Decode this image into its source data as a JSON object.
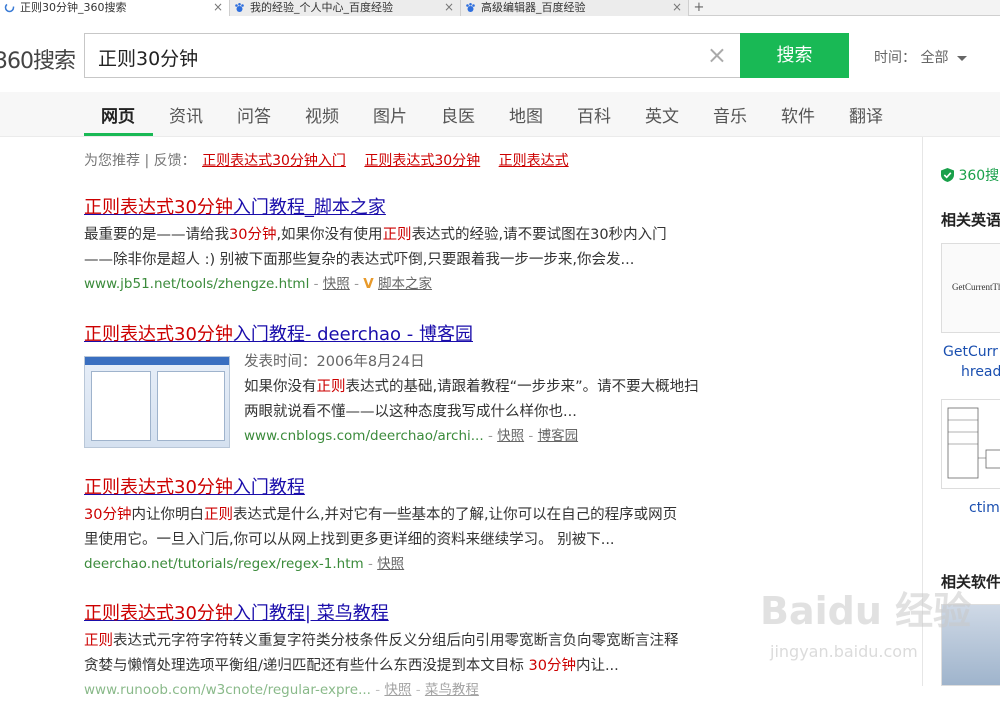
{
  "tabs": [
    {
      "label": "正则30分钟_360搜索",
      "close": "×"
    },
    {
      "label": "我的经验_个人中心_百度经验",
      "close": "×"
    },
    {
      "label": "高级编辑器_百度经验",
      "close": "×"
    }
  ],
  "new_tab": "+",
  "logo": "360搜索",
  "search": {
    "query": "正则30分钟",
    "clear": "×",
    "button": "搜索"
  },
  "time_filter": {
    "label": "时间：",
    "value": "全部"
  },
  "nav": [
    "网页",
    "资讯",
    "问答",
    "视频",
    "图片",
    "良医",
    "地图",
    "百科",
    "英文",
    "音乐",
    "软件",
    "翻译"
  ],
  "recommend": {
    "prefix": "为您推荐 | 反馈：",
    "items": [
      "正则表达式30分钟入门",
      "正则表达式30分钟",
      "正则表达式"
    ]
  },
  "results": [
    {
      "title_red1": "正则",
      "title_mid": "表达式",
      "title_red2": "30分钟",
      "title_rest": "入门教程_脚本之家",
      "snip1_a": "最重要的是——请给我",
      "snip1_red": "30分钟",
      "snip1_b": ",如果你没有使用",
      "snip1_red2": "正则",
      "snip1_c": "表达式的经验,请不要试图在30秒内入门",
      "snip2": "——除非你是超人 :) 别被下面那些复杂的表达式吓倒,只要跟着我一步一步来,你会发...",
      "url": "www.jb51.net/tools/zhengze.html",
      "snap": "快照",
      "vmark": "V",
      "source": "脚本之家"
    },
    {
      "title_red1": "正则",
      "title_mid": "表达式",
      "title_red2": "30分钟",
      "title_rest": "入门教程- deerchao - 博客园",
      "date": "发表时间：2006年8月24日",
      "snip1_a": "如果你没有",
      "snip1_red": "正则",
      "snip1_b": "表达式的基础,请跟着教程“一步步来”。请不要大概地扫",
      "snip2": "两眼就说看不懂——以这种态度我写成什么样你也...",
      "url": "www.cnblogs.com/deerchao/archi...",
      "snap": "快照",
      "source": "博客园"
    },
    {
      "title_red1": "正则",
      "title_mid": "表达式",
      "title_red2": "30分钟",
      "title_rest": "入门教程",
      "snip1_red": "30分钟",
      "snip1_a": "内让你明白",
      "snip1_red2": "正则",
      "snip1_b": "表达式是什么,并对它有一些基本的了解,让你可以在自己的程序或网页",
      "snip2": "里使用它。一旦入门后,你可以从网上找到更多更详细的资料来继续学习。 别被下...",
      "url": "deerchao.net/tutorials/regex/regex-1.htm",
      "snap": "快照"
    },
    {
      "title_red1": "正则",
      "title_mid": "表达式",
      "title_red2": "30分钟",
      "title_rest": "入门教程| 菜鸟教程",
      "snip1_red": "正则",
      "snip1_a": "表达式元字符字符转义重复字符类分枝条件反义分组后向引用零宽断言负向零宽断言注释",
      "snip2_a": "贪婪与懒惰处理选项平衡组/递归匹配还有些什么东西没提到本文目标 ",
      "snip2_red": "30分钟",
      "snip2_b": "内让...",
      "url": "www.runoob.com/w3cnote/regular-expre...",
      "snap": "快照",
      "source": "菜鸟教程"
    }
  ],
  "sidebar": {
    "badge": "360搜",
    "heading1": "相关英语",
    "img1_text": "GetCurrentThr",
    "link1_line1": "GetCurr",
    "link1_line2": "hread",
    "link2": "ctime",
    "heading2": "相关软件"
  },
  "watermark": {
    "main": "Baidu 经验",
    "sub": "jingyan.baidu.com"
  },
  "colors": {
    "accent": "#19b955",
    "link": "#1a0dab",
    "highlight": "#cc0000",
    "url": "#3b8b3b"
  }
}
